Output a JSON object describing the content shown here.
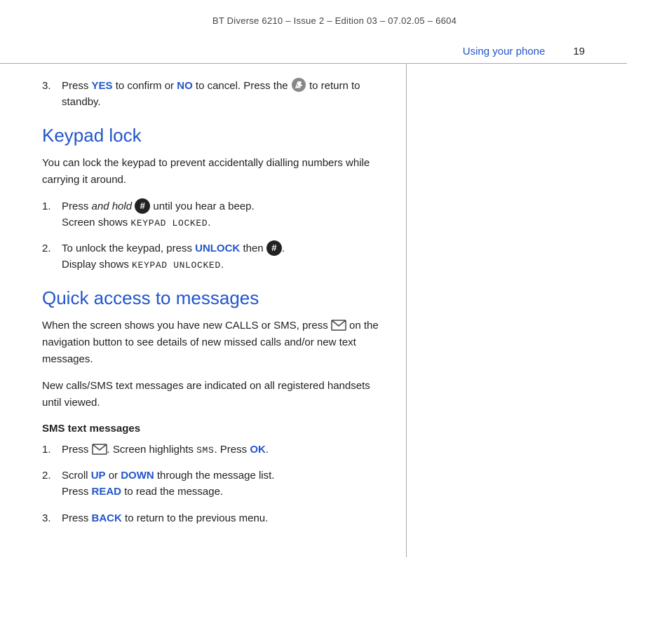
{
  "header": {
    "title": "BT Diverse 6210 – Issue 2 – Edition 03 – 07.02.05 – 6604"
  },
  "section_header": {
    "title": "Using your phone",
    "page_number": "19"
  },
  "content": {
    "step3_intro": {
      "num": "3.",
      "text_before_yes": "Press ",
      "yes": "YES",
      "text_before_no": " to confirm or ",
      "no": "NO",
      "text_after": " to cancel. Press the",
      "text_end": "to return to standby."
    },
    "keypad_lock": {
      "heading": "Keypad lock",
      "desc": "You can lock the keypad to prevent accidentally dialling numbers while carrying it around.",
      "step1": {
        "num": "1.",
        "text_before": "Press ",
        "italic": "and hold",
        "text_mid": " until you hear a beep.",
        "text_line2": "Screen shows ",
        "mono": "KEYPAD LOCKED",
        "mono_end": "."
      },
      "step2": {
        "num": "2.",
        "text_before": "To unlock the keypad, press ",
        "unlock": "UNLOCK",
        "text_mid": " then",
        "text_line2": "Display shows ",
        "mono": "KEYPAD UNLOCKED",
        "mono_end": "."
      }
    },
    "quick_access": {
      "heading": "Quick access to messages",
      "desc1": "When the screen shows you have new CALLS or SMS, press",
      "desc1_end": "on the navigation button to see details of new missed calls and/or new text messages.",
      "desc2": "New calls/SMS text messages are indicated on all registered handsets until viewed.",
      "sms_heading": "SMS text messages",
      "sms_step1": {
        "num": "1.",
        "text_before": "Press",
        "text_mid": ". Screen highlights ",
        "mono": "SMS",
        "text_end": ". Press ",
        "ok": "OK",
        "ok_end": "."
      },
      "sms_step2": {
        "num": "2.",
        "text_before": "Scroll ",
        "up": "UP",
        "text_mid": " or ",
        "down": "DOWN",
        "text_end": " through the message list.",
        "line2_before": "Press ",
        "read": "READ",
        "line2_end": " to read the message."
      },
      "sms_step3": {
        "num": "3.",
        "text_before": "Press ",
        "back": "BACK",
        "text_end": " to return to the previous menu."
      }
    }
  }
}
